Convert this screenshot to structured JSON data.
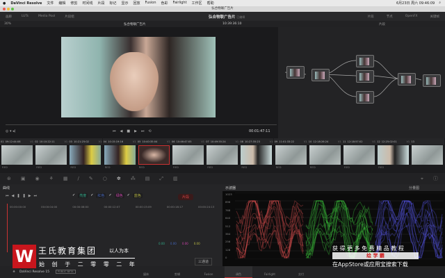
{
  "menubar": {
    "app": "DaVinci Resolve",
    "items": [
      "文件",
      "编辑",
      "修剪",
      "时间线",
      "片段",
      "标记",
      "显示",
      "回放",
      "Fusion",
      "色彩",
      "Fairlight",
      "工作区",
      "帮助"
    ],
    "datetime": "6月23日 周六 09:46:09"
  },
  "window_title": "弘合物联广告片",
  "toolbar": {
    "left": [
      "画廊",
      "LUTs",
      "Media Pool",
      "片段组"
    ],
    "project": "弘合物联广告片",
    "status": "已编辑",
    "right": [
      "片段",
      "节点",
      "OpenFX",
      "关键帧"
    ]
  },
  "subbar": {
    "zoom": "30%",
    "timeline": "弘合物联广告片",
    "timecode": "10:39:36:10",
    "mode": "片段"
  },
  "viewer": {
    "timecode": "00:01:47:11"
  },
  "clips": [
    {
      "n": "01",
      "tc": "09:12:44:08",
      "tr": "V1"
    },
    {
      "n": "02",
      "tc": "10:10:22:11",
      "tr": "V1"
    },
    {
      "n": "03",
      "tc": "10:21:25:02",
      "tr": "V1"
    },
    {
      "n": "04",
      "tc": "10:15:19:16",
      "tr": "V1"
    },
    {
      "n": "05",
      "tc": "10:40:35:04",
      "tr": "V1"
    },
    {
      "n": "06",
      "tc": "10:46:47:05",
      "tr": "V1"
    },
    {
      "n": "07",
      "tc": "10:49:55:24",
      "tr": "V1"
    },
    {
      "n": "08",
      "tc": "10:27:35:23",
      "tr": "V1"
    },
    {
      "n": "09",
      "tc": "11:01:33:22",
      "tr": "V1"
    },
    {
      "n": "10",
      "tc": "12:18:26:24",
      "tr": "V1"
    },
    {
      "n": "11",
      "tc": "12:18:57:02",
      "tr": "V1"
    },
    {
      "n": "12",
      "tc": "12:25:02:01",
      "tr": "V1"
    },
    {
      "n": "13",
      "tc": "",
      "tr": ""
    }
  ],
  "clip_label": "RED",
  "curves": {
    "title": "曲线",
    "channels": [
      "Y",
      "R",
      "G",
      "B"
    ],
    "channel_labels": [
      "亮度",
      "红色",
      "绿色",
      "蓝色"
    ],
    "times": [
      "00:00:00:00",
      "00:00:04:00",
      "00:00:08:00",
      "00:00:12:07",
      "00:00:15:09",
      "00:00:18:17",
      "00:00:24:13"
    ],
    "values": [
      "0.00",
      "0.00",
      "0.00",
      "0.00"
    ],
    "button": "片段",
    "dropdown": "三通道"
  },
  "scope": {
    "title": "示波器",
    "mode": "分量图",
    "ticks": [
      "1023",
      "896",
      "768",
      "640",
      "512",
      "384",
      "256",
      "128",
      "0"
    ]
  },
  "pages": [
    "媒体",
    "剪辑",
    "Fusion",
    "调色",
    "Fairlight",
    "交付"
  ],
  "brand": {
    "name": "DaVinci Resolve 15",
    "badge": "PUBLIC BETA"
  },
  "watermark": {
    "org": "王氏教育集团",
    "motto": "以人为本",
    "since": "始 创 于 二 零 零 二 年",
    "promo": "获 得 更 多 免 费 精 品 教 程",
    "app": "绘 学 霸",
    "store": "在AppStore或应用宝搜索下载"
  }
}
